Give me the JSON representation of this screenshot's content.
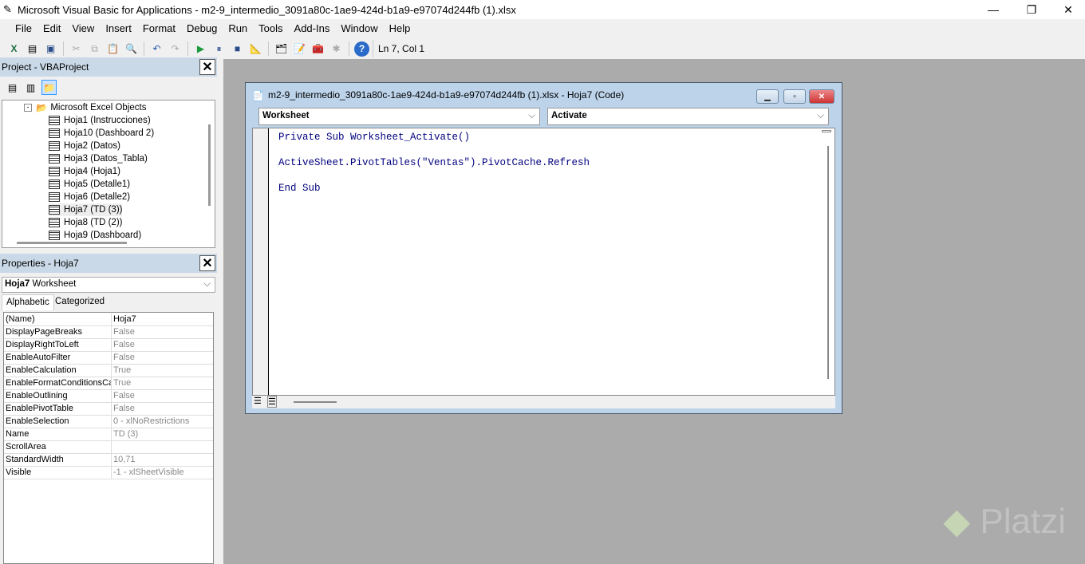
{
  "window": {
    "title": "Microsoft Visual Basic for Applications - m2-9_intermedio_3091a80c-1ae9-424d-b1a9-e97074d244fb (1).xlsx"
  },
  "menu": [
    "File",
    "Edit",
    "View",
    "Insert",
    "Format",
    "Debug",
    "Run",
    "Tools",
    "Add-Ins",
    "Window",
    "Help"
  ],
  "toolbar": {
    "position": "Ln 7, Col 1"
  },
  "project": {
    "title": "Project - VBAProject",
    "folder": "Microsoft Excel Objects",
    "items": [
      "Hoja1 (Instrucciones)",
      "Hoja10 (Dashboard 2)",
      "Hoja2 (Datos)",
      "Hoja3 (Datos_Tabla)",
      "Hoja4 (Hoja1)",
      "Hoja5 (Detalle1)",
      "Hoja6 (Detalle2)",
      "Hoja7 (TD (3))",
      "Hoja8 (TD (2))",
      "Hoja9 (Dashboard)"
    ]
  },
  "properties": {
    "title": "Properties - Hoja7",
    "object_name": "Hoja7",
    "object_type": "Worksheet",
    "tabs": [
      "Alphabetic",
      "Categorized"
    ],
    "rows": [
      [
        "(Name)",
        "Hoja7"
      ],
      [
        "DisplayPageBreaks",
        "False"
      ],
      [
        "DisplayRightToLeft",
        "False"
      ],
      [
        "EnableAutoFilter",
        "False"
      ],
      [
        "EnableCalculation",
        "True"
      ],
      [
        "EnableFormatConditionsCal",
        "True"
      ],
      [
        "EnableOutlining",
        "False"
      ],
      [
        "EnablePivotTable",
        "False"
      ],
      [
        "EnableSelection",
        "0 - xlNoRestrictions"
      ],
      [
        "Name",
        "TD (3)"
      ],
      [
        "ScrollArea",
        ""
      ],
      [
        "StandardWidth",
        "10,71"
      ],
      [
        "Visible",
        "-1 - xlSheetVisible"
      ]
    ]
  },
  "code_window": {
    "title": "m2-9_intermedio_3091a80c-1ae9-424d-b1a9-e97074d244fb (1).xlsx - Hoja7 (Code)",
    "object": "Worksheet",
    "procedure": "Activate",
    "lines": [
      "Private Sub Worksheet_Activate()",
      "",
      "ActiveSheet.PivotTables(\"Ventas\").PivotCache.Refresh",
      "",
      "End Sub"
    ]
  },
  "watermark": "Platzi"
}
